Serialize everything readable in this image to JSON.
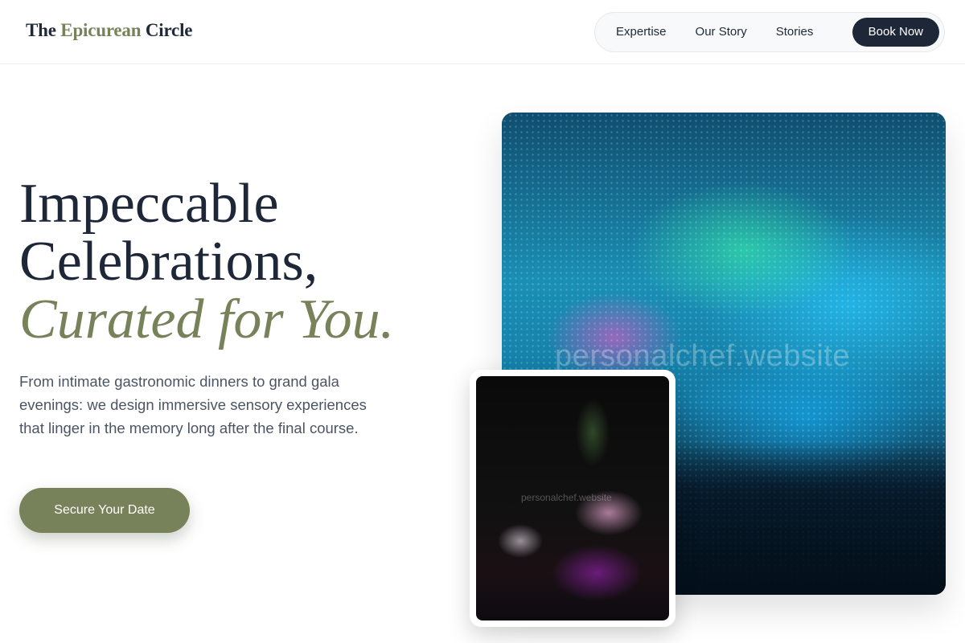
{
  "header": {
    "brand": {
      "part1": "The ",
      "accent": "Epicurean",
      "part2": " Circle"
    },
    "nav": [
      {
        "label": "Expertise"
      },
      {
        "label": "Our Story"
      },
      {
        "label": "Stories"
      }
    ],
    "cta_label": "Book Now"
  },
  "hero": {
    "headline_line1": "Impeccable",
    "headline_line2": "Celebrations,",
    "headline_line3": "Curated for You.",
    "subtext": "From intimate gastronomic dinners to grand gala evenings: we design immersive sensory experiences that linger in the memory long after the final course.",
    "cta_label": "Secure Your Date"
  },
  "images": {
    "main_watermark": "personalchef.website",
    "small_watermark": "personalchef.website"
  },
  "colors": {
    "accent": "#77815a",
    "dark": "#1e2738",
    "text_muted": "#4b5563"
  }
}
